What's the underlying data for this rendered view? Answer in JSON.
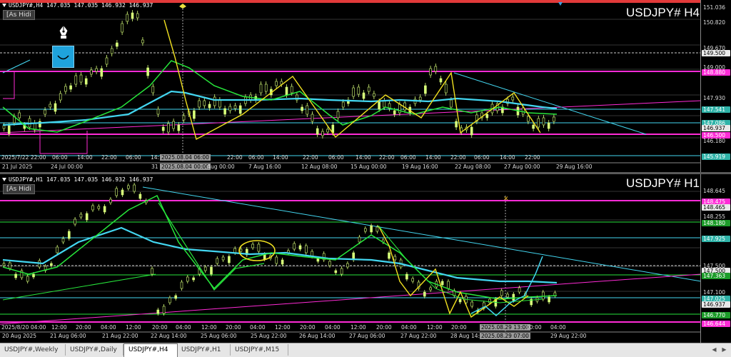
{
  "top": {
    "header": "USDJPY#,H4  147.035 147.035 146.932 146.937",
    "ashidi": "[As Hidi",
    "symbol": "USDJPY# H4",
    "price_labels": [
      {
        "text": "151.036",
        "style": "plain"
      },
      {
        "text": "150.820",
        "style": "plain"
      },
      {
        "text": "149.670",
        "style": "plain"
      },
      {
        "text": "149.500",
        "style": "box-white"
      },
      {
        "text": "149.000",
        "style": "plain"
      },
      {
        "text": "148.880",
        "style": "box-magenta"
      },
      {
        "text": "147.930",
        "style": "plain"
      },
      {
        "text": "147.541",
        "style": "box-teal"
      },
      {
        "text": "147.086",
        "style": "box-teal"
      },
      {
        "text": "146.937",
        "style": "box-white"
      },
      {
        "text": "146.500",
        "style": "box-magenta"
      },
      {
        "text": "146.180",
        "style": "plain"
      },
      {
        "text": "145.919",
        "style": "box-teal"
      }
    ],
    "time_labels": [
      "21 Jul 2025",
      "24 Jul 00:00",
      "31",
      "2025.08.04 00:00",
      "Aug 00:00",
      "7 Aug 16:00",
      "12 Aug 08:00",
      "15 Aug 00:00",
      "19 Aug 16:00",
      "22 Aug 08:00",
      "27 Aug 00:00",
      "29 Aug 16:00"
    ],
    "inner_time_labels": [
      "2025/7/22 22:00",
      "06:00",
      "14:00",
      "22:00",
      "06:00",
      "14:",
      "2025.08.04 06:00",
      "22:00",
      "06:00",
      "14:00",
      "22:00",
      "06:00",
      "14:00",
      "22:00",
      "06:00",
      "14:00",
      "22:00",
      "06:00",
      "14:00",
      "22:00"
    ]
  },
  "bottom": {
    "header": "USDJPY#,H1  147.035 147.035 146.932 146.937",
    "ashidi": "[As Hidi",
    "symbol": "USDJPY# H1",
    "price_labels": [
      {
        "text": "148.645",
        "style": "plain"
      },
      {
        "text": "148.475",
        "style": "box-magenta"
      },
      {
        "text": "148.465",
        "style": "box-white"
      },
      {
        "text": "148.255",
        "style": "plain"
      },
      {
        "text": "148.180",
        "style": "box-green"
      },
      {
        "text": "147.925",
        "style": "box-teal"
      },
      {
        "text": "147.500",
        "style": "plain"
      },
      {
        "text": "147.500",
        "style": "box-white"
      },
      {
        "text": "147.363",
        "style": "box-green"
      },
      {
        "text": "147.100",
        "style": "plain"
      },
      {
        "text": "147.025",
        "style": "box-teal"
      },
      {
        "text": "146.937",
        "style": "box-white"
      },
      {
        "text": "146.770",
        "style": "box-green"
      },
      {
        "text": "146.644",
        "style": "box-magenta"
      }
    ],
    "time_labels": [
      "20 Aug 2025",
      "21 Aug 06:00",
      "21 Aug 22:00",
      "22 Aug 14:00",
      "25 Aug 06:00",
      "25 Aug 22:00",
      "26 Aug 14:00",
      "27 Aug 06:00",
      "27 Aug 22:00",
      "28 Aug 14:00",
      "2025.08.29 07:00",
      "29 Aug 22:00"
    ],
    "inner_time_labels": [
      "2025/8/20 04:00",
      "12:00",
      "20:00",
      "04:00",
      "12:00",
      "20:00",
      "04:00",
      "12:00",
      "20:00",
      "04:00",
      "12:00",
      "20:00",
      "04:00",
      "12:00",
      "20:00",
      "04:00",
      "12:00",
      "20:00",
      "2025.08.29 13:00",
      "00:00",
      "04:00"
    ]
  },
  "tabs": [
    "USDJPY#,Weekly",
    "USDJPY#,Daily",
    "USDJPY#,H4",
    "USDJPY#,H1",
    "USDJPY#,M15"
  ],
  "active_tab": "USDJPY#,H4",
  "colors": {
    "bull": "#d8ff7a",
    "bear": "#d8ff7a",
    "magenta": "#ff2bd6",
    "cyan": "#43d6f0",
    "green": "#27e53b",
    "yellow": "#f0e020",
    "teal_box": "#2fb3a8",
    "green_box": "#1d9c2a"
  },
  "icons": [
    "pen-icon",
    "smiley-icon",
    "tab-scroll-left-icon",
    "tab-scroll-right-icon"
  ]
}
